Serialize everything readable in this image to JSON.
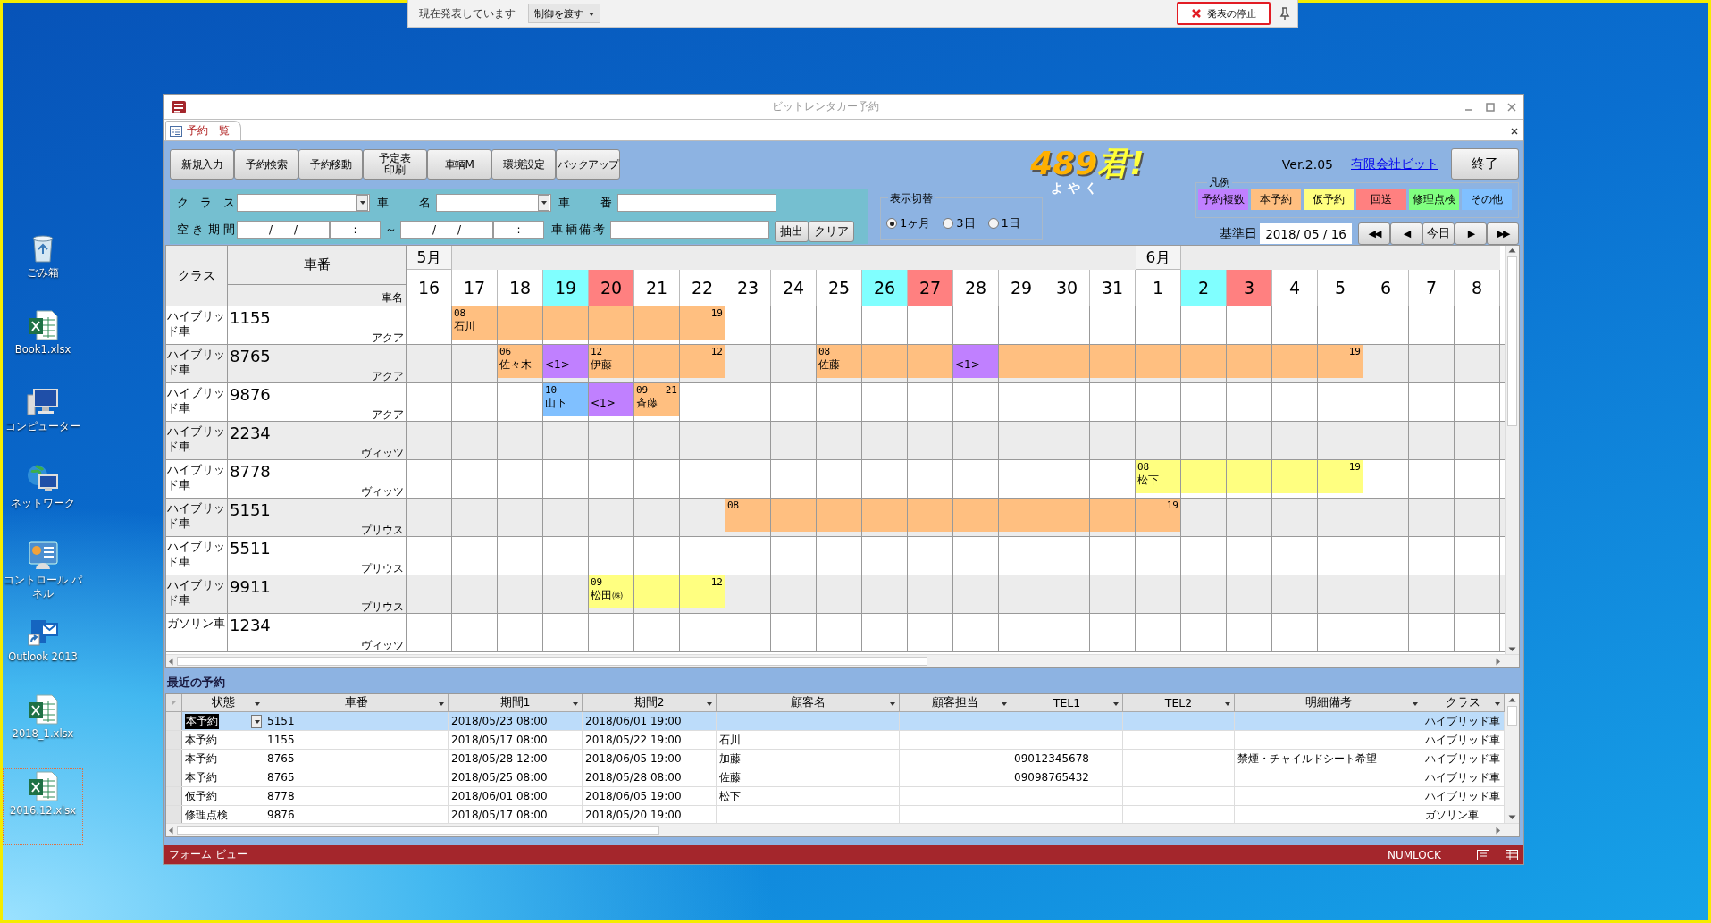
{
  "presentation_bar": {
    "status": "現在発表しています",
    "pass_control": "制御を渡す",
    "stop": "発表の停止"
  },
  "desktop_icons": [
    {
      "label": "ごみ箱",
      "kind": "trash",
      "selected": false
    },
    {
      "label": "Book1.xlsx",
      "kind": "spreadsheet",
      "selected": false
    },
    {
      "label": "コンピューター",
      "kind": "computer",
      "selected": false
    },
    {
      "label": "ネットワーク",
      "kind": "network",
      "selected": false
    },
    {
      "label": "コントロール パネル",
      "kind": "control",
      "selected": false
    },
    {
      "label": "Outlook 2013",
      "kind": "mail",
      "selected": false
    },
    {
      "label": "2018_1.xlsx",
      "kind": "spreadsheet",
      "selected": false
    },
    {
      "label": "2016.12.xlsx",
      "kind": "spreadsheet",
      "selected": true
    }
  ],
  "window": {
    "title": "ビットレンタカー予約"
  },
  "document_tab": {
    "label": "予約一覧"
  },
  "toolbar": [
    {
      "label": "新規入力"
    },
    {
      "label": "予約検索"
    },
    {
      "label": "予約移動"
    },
    {
      "lines": [
        "予定表",
        "印刷"
      ]
    },
    {
      "label": "車輌M"
    },
    {
      "label": "環境設定"
    },
    {
      "label": "バックアップ"
    }
  ],
  "filters": {
    "class_label": "ク ラ ス",
    "car_name_label": "車　名",
    "car_number_label": "車　番",
    "period_label": "空き期間",
    "from_date": {
      "placeholder": "/　　/"
    },
    "from_time": {
      "placeholder": ":"
    },
    "separator": "～",
    "to_date": {
      "placeholder": "/　　/"
    },
    "to_time": {
      "placeholder": ":"
    },
    "remarks_label": "車輌備考",
    "extract_button": "抽出",
    "clear_button": "クリア"
  },
  "display_switch": {
    "title": "表示切替",
    "options": [
      {
        "label": "1ヶ月",
        "selected": true
      },
      {
        "label": "3日",
        "selected": false
      },
      {
        "label": "1日",
        "selected": false
      }
    ]
  },
  "logo": {
    "title": "489君!",
    "subtitle": "よ や く"
  },
  "version": "Ver.2.05",
  "company_link": "有限会社ビット",
  "exit_button": "終了",
  "legend": {
    "title": "凡例",
    "items": [
      {
        "label": "予約複数",
        "color": "#c080ff"
      },
      {
        "label": "本予約",
        "color": "#ffbf80"
      },
      {
        "label": "仮予約",
        "color": "#ffff80"
      },
      {
        "label": "回送",
        "color": "#ff8080"
      },
      {
        "label": "修理点検",
        "color": "#80ff80"
      },
      {
        "label": "その他",
        "color": "#80c0ff"
      }
    ]
  },
  "base_date": {
    "label": "基準日",
    "value": "2018/ 05 / 16"
  },
  "nav_buttons": [
    "◀◀",
    "◀",
    "今日",
    "▶",
    "▶▶"
  ],
  "schedule": {
    "class_header": "クラス",
    "number_header": "車番",
    "name_header": "車名",
    "days": [
      {
        "label": "16",
        "kind": "weekday",
        "month": "5月"
      },
      {
        "label": "17",
        "kind": "weekday"
      },
      {
        "label": "18",
        "kind": "weekday"
      },
      {
        "label": "19",
        "kind": "saturday"
      },
      {
        "label": "20",
        "kind": "sunday"
      },
      {
        "label": "21",
        "kind": "weekday"
      },
      {
        "label": "22",
        "kind": "weekday"
      },
      {
        "label": "23",
        "kind": "weekday"
      },
      {
        "label": "24",
        "kind": "weekday"
      },
      {
        "label": "25",
        "kind": "weekday"
      },
      {
        "label": "26",
        "kind": "saturday"
      },
      {
        "label": "27",
        "kind": "sunday"
      },
      {
        "label": "28",
        "kind": "weekday"
      },
      {
        "label": "29",
        "kind": "weekday"
      },
      {
        "label": "30",
        "kind": "weekday"
      },
      {
        "label": "31",
        "kind": "weekday"
      },
      {
        "label": "1",
        "kind": "weekday",
        "month": "6月"
      },
      {
        "label": "2",
        "kind": "saturday"
      },
      {
        "label": "3",
        "kind": "sunday"
      },
      {
        "label": "4",
        "kind": "weekday"
      },
      {
        "label": "5",
        "kind": "weekday"
      },
      {
        "label": "6",
        "kind": "weekday"
      },
      {
        "label": "7",
        "kind": "weekday"
      },
      {
        "label": "8",
        "kind": "weekday"
      }
    ],
    "rows": [
      {
        "class": "ハイブリッド車",
        "number": "1155",
        "name": "アクア",
        "cells": [
          {
            "kind": "blank"
          },
          {
            "kind": "reserved",
            "start": "08",
            "name": "石川"
          },
          {
            "kind": "reserved"
          },
          {
            "kind": "reserved"
          },
          {
            "kind": "reserved"
          },
          {
            "kind": "reserved"
          },
          {
            "kind": "reserved",
            "end": "19"
          },
          {
            "kind": "blank"
          },
          {
            "kind": "blank"
          },
          {
            "kind": "blank"
          },
          {
            "kind": "blank"
          },
          {
            "kind": "blank"
          },
          {
            "kind": "blank"
          },
          {
            "kind": "blank"
          },
          {
            "kind": "blank"
          },
          {
            "kind": "blank"
          },
          {
            "kind": "blank"
          },
          {
            "kind": "blank"
          },
          {
            "kind": "blank"
          },
          {
            "kind": "blank"
          },
          {
            "kind": "blank"
          },
          {
            "kind": "blank"
          },
          {
            "kind": "blank"
          },
          {
            "kind": "blank"
          }
        ]
      },
      {
        "class": "ハイブリッド車",
        "number": "8765",
        "name": "アクア",
        "cells": [
          {
            "kind": "blank"
          },
          {
            "kind": "blank"
          },
          {
            "kind": "reserved",
            "start": "06",
            "name": "佐々木"
          },
          {
            "kind": "multiple",
            "note": "<1>"
          },
          {
            "kind": "reserved",
            "start": "12",
            "name": "伊藤"
          },
          {
            "kind": "reserved"
          },
          {
            "kind": "reserved",
            "end": "12"
          },
          {
            "kind": "blank"
          },
          {
            "kind": "blank"
          },
          {
            "kind": "reserved",
            "start": "08",
            "name": "佐藤"
          },
          {
            "kind": "reserved"
          },
          {
            "kind": "reserved"
          },
          {
            "kind": "multiple",
            "note": "<1>"
          },
          {
            "kind": "reserved"
          },
          {
            "kind": "reserved"
          },
          {
            "kind": "reserved"
          },
          {
            "kind": "reserved"
          },
          {
            "kind": "reserved"
          },
          {
            "kind": "reserved"
          },
          {
            "kind": "reserved"
          },
          {
            "kind": "reserved",
            "end": "19"
          },
          {
            "kind": "blank"
          },
          {
            "kind": "blank"
          },
          {
            "kind": "blank"
          }
        ]
      },
      {
        "class": "ハイブリッド車",
        "number": "9876",
        "name": "アクア",
        "cells": [
          {
            "kind": "blank"
          },
          {
            "kind": "blank"
          },
          {
            "kind": "blank"
          },
          {
            "kind": "other",
            "start": "10",
            "name": "山下"
          },
          {
            "kind": "multiple",
            "note": "<1>"
          },
          {
            "kind": "reserved",
            "start": "09",
            "end": "21",
            "name": "斉藤"
          },
          {
            "kind": "blank"
          },
          {
            "kind": "blank"
          },
          {
            "kind": "blank"
          },
          {
            "kind": "blank"
          },
          {
            "kind": "blank"
          },
          {
            "kind": "blank"
          },
          {
            "kind": "blank"
          },
          {
            "kind": "blank"
          },
          {
            "kind": "blank"
          },
          {
            "kind": "blank"
          },
          {
            "kind": "blank"
          },
          {
            "kind": "blank"
          },
          {
            "kind": "blank"
          },
          {
            "kind": "blank"
          },
          {
            "kind": "blank"
          },
          {
            "kind": "blank"
          },
          {
            "kind": "blank"
          },
          {
            "kind": "blank"
          }
        ]
      },
      {
        "class": "ハイブリッド車",
        "number": "2234",
        "name": "ヴィッツ",
        "cells": [
          {
            "kind": "blank"
          },
          {
            "kind": "blank"
          },
          {
            "kind": "blank"
          },
          {
            "kind": "blank"
          },
          {
            "kind": "blank"
          },
          {
            "kind": "blank"
          },
          {
            "kind": "blank"
          },
          {
            "kind": "blank"
          },
          {
            "kind": "blank"
          },
          {
            "kind": "blank"
          },
          {
            "kind": "blank"
          },
          {
            "kind": "blank"
          },
          {
            "kind": "blank"
          },
          {
            "kind": "blank"
          },
          {
            "kind": "blank"
          },
          {
            "kind": "blank"
          },
          {
            "kind": "blank"
          },
          {
            "kind": "blank"
          },
          {
            "kind": "blank"
          },
          {
            "kind": "blank"
          },
          {
            "kind": "blank"
          },
          {
            "kind": "blank"
          },
          {
            "kind": "blank"
          },
          {
            "kind": "blank"
          }
        ]
      },
      {
        "class": "ハイブリッド車",
        "number": "8778",
        "name": "ヴィッツ",
        "cells": [
          {
            "kind": "blank"
          },
          {
            "kind": "blank"
          },
          {
            "kind": "blank"
          },
          {
            "kind": "blank"
          },
          {
            "kind": "blank"
          },
          {
            "kind": "blank"
          },
          {
            "kind": "blank"
          },
          {
            "kind": "blank"
          },
          {
            "kind": "blank"
          },
          {
            "kind": "blank"
          },
          {
            "kind": "blank"
          },
          {
            "kind": "blank"
          },
          {
            "kind": "blank"
          },
          {
            "kind": "blank"
          },
          {
            "kind": "blank"
          },
          {
            "kind": "blank"
          },
          {
            "kind": "tentative",
            "start": "08",
            "name": "松下"
          },
          {
            "kind": "tentative"
          },
          {
            "kind": "tentative"
          },
          {
            "kind": "tentative"
          },
          {
            "kind": "tentative",
            "end": "19"
          },
          {
            "kind": "blank"
          },
          {
            "kind": "blank"
          },
          {
            "kind": "blank"
          }
        ]
      },
      {
        "class": "ハイブリッド車",
        "number": "5151",
        "name": "プリウス",
        "cells": [
          {
            "kind": "blank"
          },
          {
            "kind": "blank"
          },
          {
            "kind": "blank"
          },
          {
            "kind": "blank"
          },
          {
            "kind": "blank"
          },
          {
            "kind": "blank"
          },
          {
            "kind": "blank"
          },
          {
            "kind": "reserved",
            "start": "08"
          },
          {
            "kind": "reserved"
          },
          {
            "kind": "reserved"
          },
          {
            "kind": "reserved"
          },
          {
            "kind": "reserved"
          },
          {
            "kind": "reserved"
          },
          {
            "kind": "reserved"
          },
          {
            "kind": "reserved"
          },
          {
            "kind": "reserved"
          },
          {
            "kind": "reserved",
            "end": "19"
          },
          {
            "kind": "blank"
          },
          {
            "kind": "blank"
          },
          {
            "kind": "blank"
          },
          {
            "kind": "blank"
          },
          {
            "kind": "blank"
          },
          {
            "kind": "blank"
          },
          {
            "kind": "blank"
          }
        ]
      },
      {
        "class": "ハイブリッド車",
        "number": "5511",
        "name": "プリウス",
        "cells": [
          {
            "kind": "blank"
          },
          {
            "kind": "blank"
          },
          {
            "kind": "blank"
          },
          {
            "kind": "blank"
          },
          {
            "kind": "blank"
          },
          {
            "kind": "blank"
          },
          {
            "kind": "blank"
          },
          {
            "kind": "blank"
          },
          {
            "kind": "blank"
          },
          {
            "kind": "blank"
          },
          {
            "kind": "blank"
          },
          {
            "kind": "blank"
          },
          {
            "kind": "blank"
          },
          {
            "kind": "blank"
          },
          {
            "kind": "blank"
          },
          {
            "kind": "blank"
          },
          {
            "kind": "blank"
          },
          {
            "kind": "blank"
          },
          {
            "kind": "blank"
          },
          {
            "kind": "blank"
          },
          {
            "kind": "blank"
          },
          {
            "kind": "blank"
          },
          {
            "kind": "blank"
          },
          {
            "kind": "blank"
          }
        ]
      },
      {
        "class": "ハイブリッド車",
        "number": "9911",
        "name": "プリウス",
        "cells": [
          {
            "kind": "blank"
          },
          {
            "kind": "blank"
          },
          {
            "kind": "blank"
          },
          {
            "kind": "blank"
          },
          {
            "kind": "tentative",
            "start": "09",
            "name": "松田㈱"
          },
          {
            "kind": "tentative"
          },
          {
            "kind": "tentative",
            "end": "12"
          },
          {
            "kind": "blank"
          },
          {
            "kind": "blank"
          },
          {
            "kind": "blank"
          },
          {
            "kind": "blank"
          },
          {
            "kind": "blank"
          },
          {
            "kind": "blank"
          },
          {
            "kind": "blank"
          },
          {
            "kind": "blank"
          },
          {
            "kind": "blank"
          },
          {
            "kind": "blank"
          },
          {
            "kind": "blank"
          },
          {
            "kind": "blank"
          },
          {
            "kind": "blank"
          },
          {
            "kind": "blank"
          },
          {
            "kind": "blank"
          },
          {
            "kind": "blank"
          },
          {
            "kind": "blank"
          }
        ]
      },
      {
        "class": "ガソリン車",
        "number": "1234",
        "name": "ヴィッツ",
        "cells": [
          {
            "kind": "blank"
          },
          {
            "kind": "blank"
          },
          {
            "kind": "blank"
          },
          {
            "kind": "blank"
          },
          {
            "kind": "blank"
          },
          {
            "kind": "blank"
          },
          {
            "kind": "blank"
          },
          {
            "kind": "blank"
          },
          {
            "kind": "blank"
          },
          {
            "kind": "blank"
          },
          {
            "kind": "blank"
          },
          {
            "kind": "blank"
          },
          {
            "kind": "blank"
          },
          {
            "kind": "blank"
          },
          {
            "kind": "blank"
          },
          {
            "kind": "blank"
          },
          {
            "kind": "blank"
          },
          {
            "kind": "blank"
          },
          {
            "kind": "blank"
          },
          {
            "kind": "blank"
          },
          {
            "kind": "blank"
          },
          {
            "kind": "blank"
          },
          {
            "kind": "blank"
          },
          {
            "kind": "blank"
          }
        ]
      }
    ]
  },
  "recent": {
    "title": "最近の予約",
    "columns": [
      "状態",
      "車番",
      "期間1",
      "期間2",
      "顧客名",
      "顧客担当",
      "TEL1",
      "TEL2",
      "明細備考",
      "クラス"
    ],
    "rows": [
      {
        "selected": true,
        "status": "本予約",
        "number": "5151",
        "period1": "2018/05/23 08:00",
        "period2": "2018/06/01 19:00",
        "class": "ハイブリッド車"
      },
      {
        "selected": false,
        "status": "本予約",
        "number": "1155",
        "period1": "2018/05/17 08:00",
        "period2": "2018/05/22 19:00",
        "customer": "石川",
        "class": "ハイブリッド車"
      },
      {
        "selected": false,
        "status": "本予約",
        "number": "8765",
        "period1": "2018/05/28 12:00",
        "period2": "2018/06/05 19:00",
        "customer": "加藤",
        "tel1": "09012345678",
        "note": "禁煙・チャイルドシート希望",
        "class": "ハイブリッド車"
      },
      {
        "selected": false,
        "status": "本予約",
        "number": "8765",
        "period1": "2018/05/25 08:00",
        "period2": "2018/05/28 08:00",
        "customer": "佐藤",
        "tel1": "09098765432",
        "class": "ハイブリッド車"
      },
      {
        "selected": false,
        "status": "仮予約",
        "number": "8778",
        "period1": "2018/06/01 08:00",
        "period2": "2018/06/05 19:00",
        "customer": "松下",
        "class": "ハイブリッド車"
      },
      {
        "selected": false,
        "status": "修理点検",
        "number": "9876",
        "period1": "2018/05/17 08:00",
        "period2": "2018/05/20 19:00",
        "class": "ガソリン車"
      }
    ]
  },
  "status_bar": {
    "mode": "フォーム ビュー",
    "numlock": "NUMLOCK"
  }
}
